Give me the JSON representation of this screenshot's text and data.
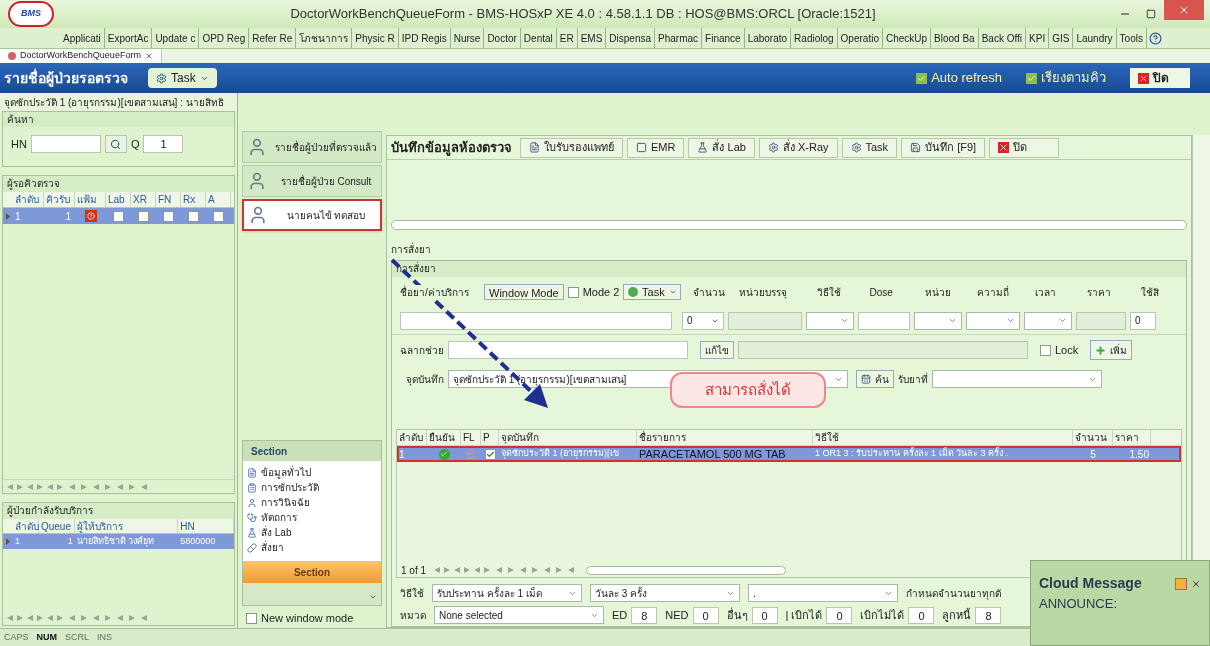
{
  "window": {
    "title": "DoctorWorkBenchQueueForm - BMS-HOSxP XE 4.0 : 4.58.1.1 DB : HOS@BMS:ORCL [Oracle:1521]",
    "logo": "BMS"
  },
  "menu_tabs": [
    "Applicati",
    "ExportAc",
    "Update c",
    "OPD Reg",
    "Refer Re",
    "โภชนาการ",
    "Physic R",
    "IPD Regis",
    "Nurse",
    "Doctor",
    "Dental",
    "ER",
    "EMS",
    "Dispensa",
    "Pharmac",
    "Finance",
    "Laborato",
    "Radiolog",
    "Operatio",
    "CheckUp",
    "Blood Ba",
    "Back Offi",
    "KPI",
    "GIS",
    "Laundry",
    "Tools"
  ],
  "document_tab": {
    "label": "DoctorWorkBenchQueueForm"
  },
  "header": {
    "title": "รายชื่อผู้ป่วยรอตรวจ",
    "task_button": "Task",
    "toggles": [
      {
        "label": "Auto refresh",
        "checked": true
      },
      {
        "label": "เรียงตามคิว",
        "checked": true
      }
    ],
    "close_button": "ปิด"
  },
  "left_panel": {
    "breadcrumb": "จุดซักประวัติ 1 (อายุรกรรม)[เขตสามเสน] : นายสิทธิ",
    "search": {
      "title": "ค้นหา",
      "hn_label": "HN",
      "q_label": "Q",
      "q_value": "1"
    },
    "waiting": {
      "title": "ผู้รอคิวตรวจ",
      "columns": [
        "ลำดับ",
        "คิวรับ",
        "แฟ้ม",
        "Lab",
        "XR",
        "FN",
        "Rx",
        "A"
      ],
      "rows": [
        {
          "index": "1",
          "queue": "1",
          "file_missing": true,
          "checks": [
            false,
            false,
            false,
            false,
            false
          ],
          "selected": true
        }
      ]
    },
    "serving": {
      "title": "ผู้ป่วยกำลังรับบริการ",
      "columns": [
        "ลำดับ",
        "Queue",
        "ผู้ให้บริการ",
        "HN"
      ],
      "rows": [
        {
          "cells": [
            "1",
            "1",
            "นายสิทธิชาติ วงศ์ยุท",
            "5800000"
          ],
          "selected": true
        }
      ]
    }
  },
  "nav_buttons": [
    {
      "label": "รายชื่อผู้ป่วยที่ตรวจแล้ว",
      "selected": false
    },
    {
      "label": "รายชื่อผู้ป่วย Consult",
      "selected": false
    },
    {
      "label": "นายคนไข้ ทดสอบ",
      "selected": true
    }
  ],
  "section_panel": {
    "title": "Section",
    "items": [
      "ข้อมูลทั่วไป",
      "การซักประวัติ",
      "การวินิจฉัย",
      "หัตถการ",
      "สั่ง Lab",
      "สั่งยา"
    ],
    "section_button": "Section",
    "new_window_mode": {
      "label": "New window mode",
      "checked": false
    }
  },
  "toolbar": {
    "title": "บันทึกข้อมูลห้องตรวจ",
    "buttons": [
      "ใบรับรองแพทย์",
      "EMR",
      "สั่ง Lab",
      "สั่ง X-Ray",
      "Task",
      "บันทึก [F9]",
      "ปิด"
    ]
  },
  "order_label": "การสั่งยา",
  "order_group": {
    "title": "การสั่งยา",
    "drug_label": "ชื่อยา/ค่าบริการ",
    "window_mode_button": "Window Mode",
    "mode2": {
      "label": "Mode 2",
      "checked": false
    },
    "task_button": "Task",
    "columns": [
      "จำนวน",
      "หน่วยบรรจุ",
      "วิธีใช้",
      "Dose",
      "หน่วย",
      "ความถี่",
      "เวลา",
      "ราคา",
      "ใช้สิ"
    ],
    "qty_value": "0",
    "last_value": "0",
    "label_help": "ฉลากช่วย",
    "edit_button": "แก้ไข",
    "lock": {
      "label": "Lock",
      "checked": false
    },
    "add_button": "เพิ่ม",
    "point_label": "จุดบันทึก",
    "point_value": "จุดซักประวัติ 1 (อายุรกรรม)[เขตสามเสน]",
    "find_button": "ค้น",
    "receive_label": "รับยาที่"
  },
  "order_table": {
    "columns": [
      "ลำดับ",
      "ยืนยัน",
      "FL",
      "P",
      "จุดบันทึก",
      "ชื่อรายการ",
      "วิธีใช้",
      "จำนวน",
      "ราคา"
    ],
    "rows": [
      {
        "index": "1",
        "confirmed": true,
        "p_checked": true,
        "point": "จุดซักประวัติ 1 (อายุรกรรม)[เข",
        "name": "PARACETAMOL 500 MG TAB",
        "usage": "1 OR1 3 : รับประทาน ครั้งละ 1 เม็ด วันละ 3 ครั้ง .",
        "qty": "5",
        "price": "1.50",
        "selected": true
      }
    ],
    "pager": "1 of 1"
  },
  "callout": "สามารถสั่งได้",
  "bottom_form": {
    "usage_label": "วิธีใช้",
    "usage_value": "รับประทาน ครั้งละ 1 เม็ด",
    "frequency_value": "วันละ 3 ครั้ง",
    "extra_value": ".",
    "set_label": "กำหนดจำนวนยาทุกตั",
    "category_label": "หมวด",
    "category_value": "None selected",
    "counters": [
      {
        "label": "ED",
        "value": "8"
      },
      {
        "label": "NED",
        "value": "0"
      },
      {
        "label": "อื่นๆ",
        "value": "0"
      },
      {
        "label": "| เบิกได้",
        "value": "0"
      },
      {
        "label": "เบิกไม่ได้",
        "value": "0"
      },
      {
        "label": "ลูกหนี้",
        "value": "8"
      }
    ]
  },
  "cloud_message": {
    "title": "Cloud Message",
    "text": "ANNOUNCE:"
  },
  "status_bar": [
    {
      "label": "CAPS",
      "on": false
    },
    {
      "label": "NUM",
      "on": true
    },
    {
      "label": "SCRL",
      "on": false
    },
    {
      "label": "INS",
      "on": false
    }
  ]
}
